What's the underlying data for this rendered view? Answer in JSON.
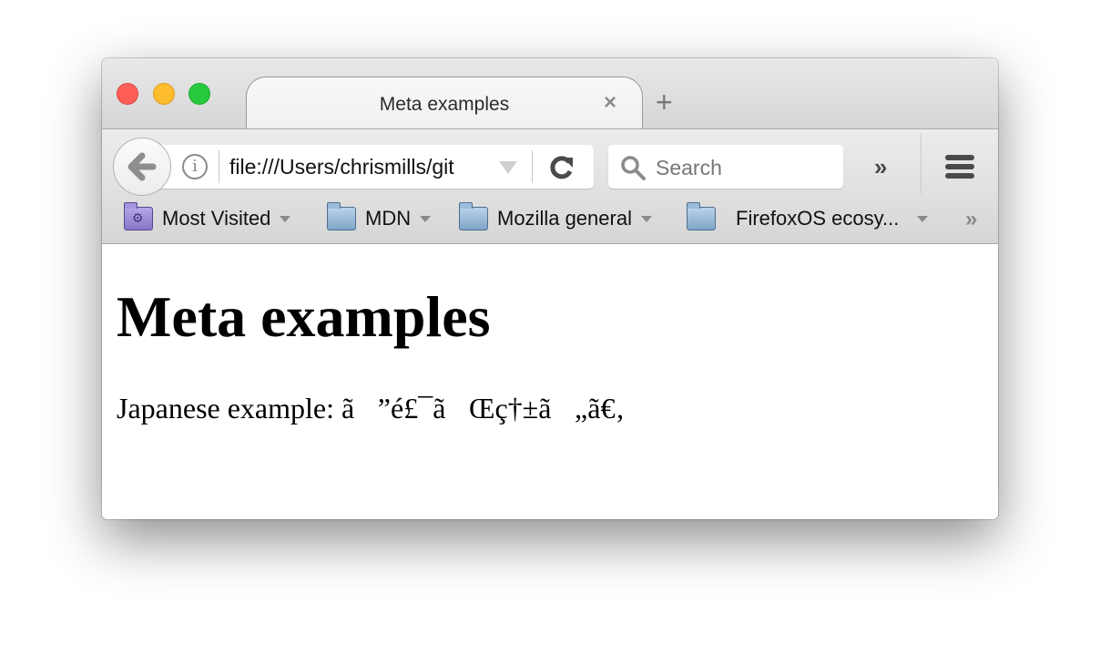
{
  "window": {
    "traffic_lights": [
      "close",
      "minimize",
      "zoom"
    ]
  },
  "tabs": [
    {
      "title": "Meta examples",
      "active": true,
      "close_icon": "close-icon"
    }
  ],
  "new_tab_label": "+",
  "navbar": {
    "back_icon": "arrow-left-icon",
    "info_icon_glyph": "i",
    "url": "file:///Users/chrismills/git",
    "search_placeholder": "Search",
    "overflow_glyph": "»"
  },
  "bookmarks": {
    "items": [
      {
        "label": "Most Visited",
        "icon": "smart-folder-icon",
        "has_dropdown": true
      },
      {
        "label": "MDN",
        "icon": "folder-icon",
        "has_dropdown": true
      },
      {
        "label": "Mozilla general",
        "icon": "folder-icon",
        "has_dropdown": true
      },
      {
        "label": "FirefoxOS ecosy...",
        "icon": "folder-icon",
        "has_dropdown": true
      }
    ],
    "overflow_glyph": "»"
  },
  "page": {
    "heading": "Meta examples",
    "paragraph": "Japanese example: ã”é£¯ãŒç†±ã„ã€‚"
  }
}
